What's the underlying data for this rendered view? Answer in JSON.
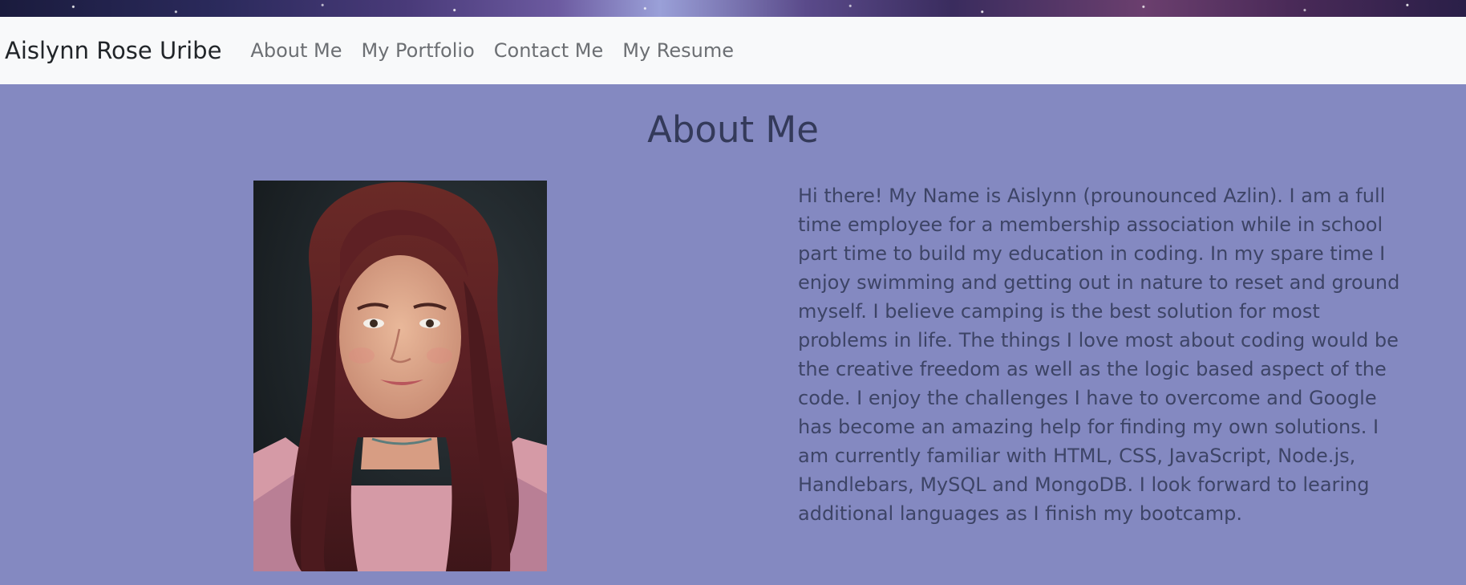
{
  "navbar": {
    "brand": "Aislynn Rose Uribe",
    "links": [
      {
        "label": "About Me"
      },
      {
        "label": "My Portfolio"
      },
      {
        "label": "Contact Me"
      },
      {
        "label": "My Resume"
      }
    ]
  },
  "main": {
    "title": "About Me",
    "bio": "Hi there! My Name is Aislynn (prounounced Azlin). I am a full time employee for a membership association while in school part time to build my education in coding. In my spare time I enjoy swimming and getting out in nature to reset and ground myself. I believe camping is the best solution for most problems in life. The things I love most about coding would be the creative freedom as well as the logic based aspect of the code. I enjoy the challenges I have to overcome and Google has become an amazing help for finding my own solutions. I am currently familiar with HTML, CSS, JavaScript, Node.js, Handlebars, MySQL and MongoDB. I look forward to learing additional languages as I finish my bootcamp."
  },
  "colors": {
    "page_background": "#8489c1",
    "navbar_background": "#f8f9fa",
    "brand_text": "#212529",
    "nav_link_text": "#6c6f73",
    "title_text": "#343a5a",
    "bio_text": "#3d4466"
  }
}
